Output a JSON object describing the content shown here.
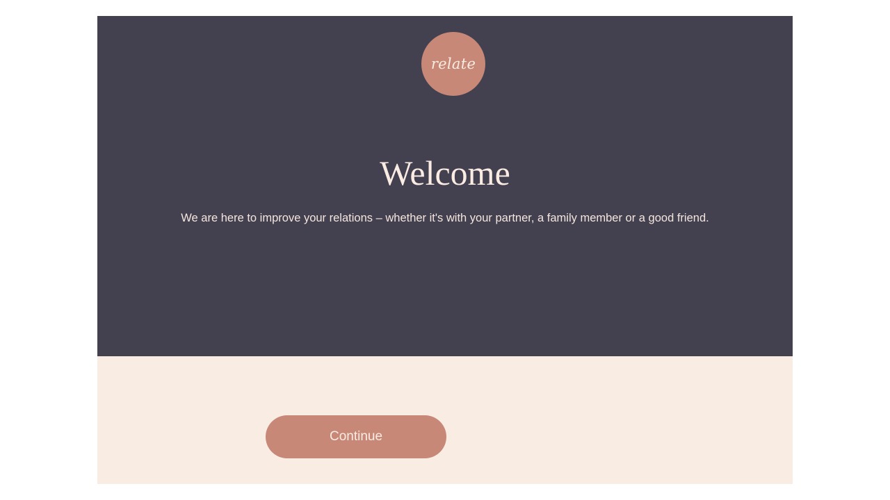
{
  "logo": {
    "text": "relate"
  },
  "welcome": {
    "title": "Welcome",
    "subtitle": "We are here to improve your relations – whether it's with your partner, a family member or a good friend."
  },
  "actions": {
    "continue_label": "Continue"
  },
  "colors": {
    "hero_background": "#434050",
    "footer_background": "#f9ece2",
    "accent": "#c78877",
    "light_text": "#faece3"
  }
}
